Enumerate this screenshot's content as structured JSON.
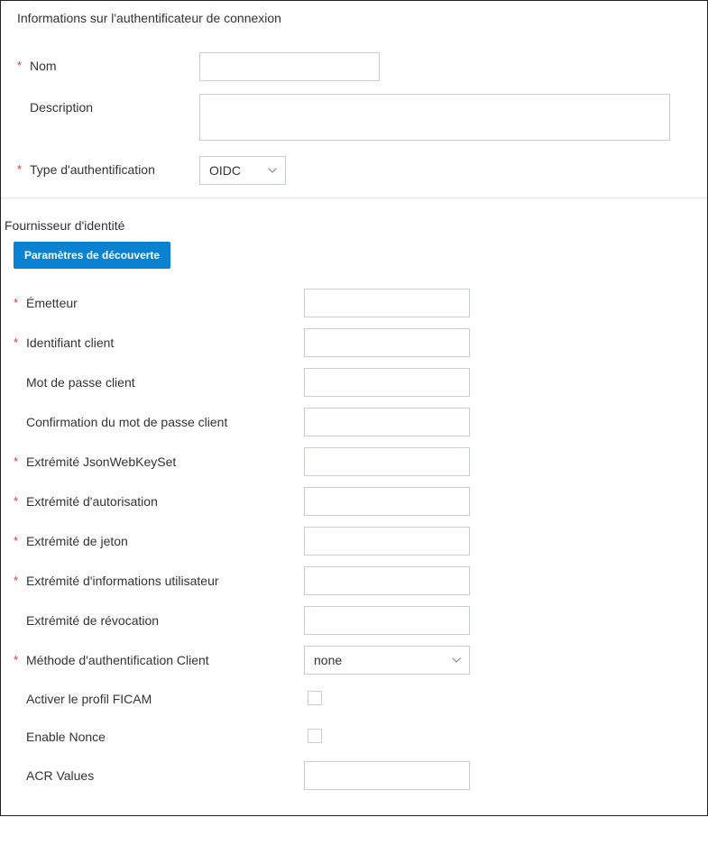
{
  "authInfo": {
    "header": "Informations sur l'authentificateur de connexion",
    "name_label": "Nom",
    "name_value": "",
    "description_label": "Description",
    "description_value": "",
    "authtype_label": "Type d'authentification",
    "authtype_value": "OIDC"
  },
  "idp": {
    "header": "Fournisseur d'identité",
    "discovery_button": "Paramètres de découverte",
    "issuer_label": "Émetteur",
    "issuer_value": "",
    "client_id_label": "Identifiant client",
    "client_id_value": "",
    "client_secret_label": "Mot de passe client",
    "client_secret_value": "",
    "client_secret_confirm_label": "Confirmation du mot de passe client",
    "client_secret_confirm_value": "",
    "jwks_label": "Extrémité JsonWebKeySet",
    "jwks_value": "",
    "authz_label": "Extrémité d'autorisation",
    "authz_value": "",
    "token_label": "Extrémité de jeton",
    "token_value": "",
    "userinfo_label": "Extrémité d'informations utilisateur",
    "userinfo_value": "",
    "revocation_label": "Extrémité de révocation",
    "revocation_value": "",
    "client_auth_method_label": "Méthode d'authentification Client",
    "client_auth_method_value": "none",
    "ficam_label": "Activer le profil FICAM",
    "nonce_label": "Enable Nonce",
    "acr_label": "ACR Values",
    "acr_value": ""
  }
}
